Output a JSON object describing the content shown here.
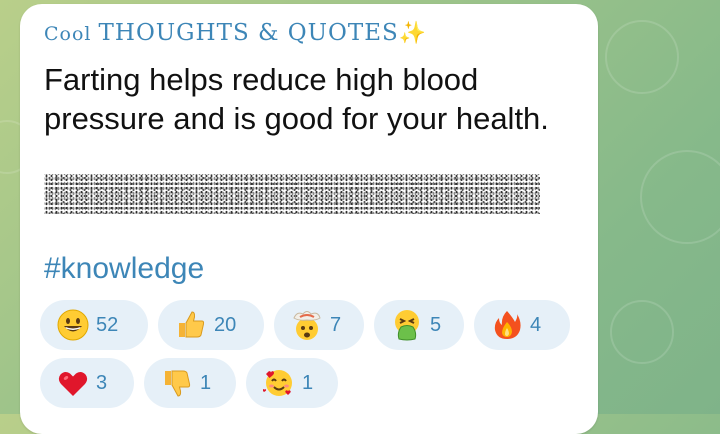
{
  "channel": {
    "name_prefix": "Cool ",
    "name_main": "THOUGHTS & QUOTES",
    "name_suffix_emoji": "✨"
  },
  "message": {
    "text": "Farting helps reduce high blood pressure and is good for your health.",
    "hashtag": "#knowledge"
  },
  "reactions": [
    {
      "emoji": "grinning-face",
      "count": "52"
    },
    {
      "emoji": "thumbs-up",
      "count": "20"
    },
    {
      "emoji": "exploding-head",
      "count": "7"
    },
    {
      "emoji": "vomiting-face",
      "count": "5"
    },
    {
      "emoji": "fire",
      "count": "4"
    },
    {
      "emoji": "red-heart",
      "count": "3"
    },
    {
      "emoji": "thumbs-down",
      "count": "1"
    },
    {
      "emoji": "smiling-face-with-hearts",
      "count": "1"
    }
  ],
  "colors": {
    "accent": "#3d86b7",
    "reaction_bg": "#e6f0f8",
    "bubble_bg": "#ffffff"
  }
}
